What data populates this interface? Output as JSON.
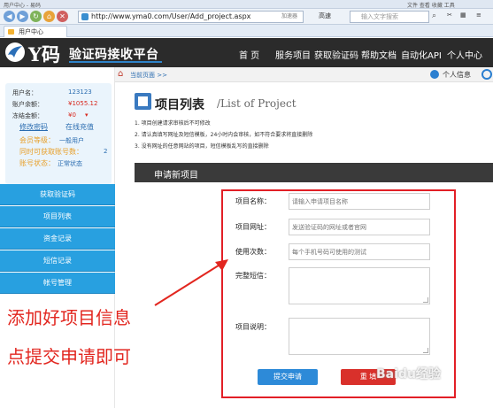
{
  "browser": {
    "title_left": "用户中心 - 易码",
    "title_right": "文件 查看 收藏 工具",
    "url": "http://www.yma0.com/User/Add_project.aspx",
    "accelerate": "加速器",
    "speed_mode": "高速",
    "search_placeholder": "输入文字搜索",
    "tab_label": "用户中心"
  },
  "header": {
    "logo_y": "Y码",
    "logo_text": "验证码接收平台",
    "nav": [
      "首 页",
      "服务项目",
      "获取验证码",
      "帮助文档",
      "自动化API",
      "个人中心"
    ]
  },
  "breadcrumb": {
    "text": "当前页面 >>",
    "personal": "个人信息"
  },
  "user": {
    "username_label": "用户名：",
    "username": "123123",
    "balance_label": "账户余额：",
    "balance": "¥1055.12",
    "frozen_label": "冻结金额：",
    "frozen": "¥0",
    "change_pwd": "修改密码",
    "recharge": "在线充值",
    "level_label": "会员等级：",
    "level": "一般用户",
    "concurrent_label": "同时可获取账号数：",
    "concurrent": "2",
    "status_label": "账号状态：",
    "status": "正常状态"
  },
  "sidebar_menu": [
    "获取验证码",
    "项目列表",
    "资金记录",
    "短信记录",
    "帐号管理"
  ],
  "main": {
    "title": "项目列表",
    "subtitle": "/List of Project",
    "notes": [
      "1. 项目创建请求审核后不可修改",
      "2. 请认真填写网址及短信模板，24小时内会审核，如不符合要求将直接删除",
      "3. 没有网址的任意网站的项目，短信模板乱写的直接删除"
    ],
    "apply_title": "申请新项目",
    "form": {
      "name_label": "项目名称：",
      "name_placeholder": "请输入申请项目名称",
      "url_label": "项目网址：",
      "url_placeholder": "发送验证码的网址或者官网",
      "count_label": "使用次数：",
      "count_placeholder": "每个手机号码可使用的测试",
      "sms_label": "完整短信：",
      "desc_label": "项目说明：",
      "submit": "提交申请",
      "reset": "重 填"
    }
  },
  "annotation": {
    "line1": "添加好项目信息",
    "line2": "点提交申请即可"
  },
  "watermark": "Baidu经验",
  "colors": {
    "header_bg": "#2b2b2b",
    "sidebar_menu": "#28a0e0",
    "submit": "#2d8ad8",
    "reset": "#d9302b",
    "annotation": "#e2261f"
  }
}
